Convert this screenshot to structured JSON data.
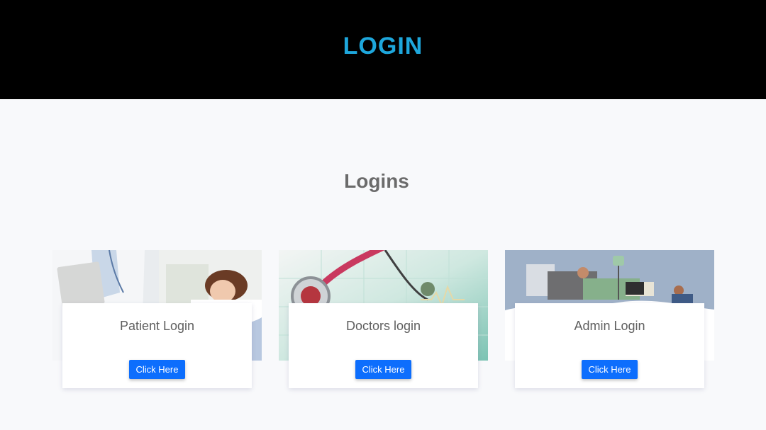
{
  "header": {
    "title": "LOGIN"
  },
  "section": {
    "title": "Logins"
  },
  "cards": [
    {
      "label": "Patient Login",
      "button_label": "Click Here",
      "image": "doctor-with-patient-photo"
    },
    {
      "label": "Doctors login",
      "button_label": "Click Here",
      "image": "stethoscope-photo"
    },
    {
      "label": "Admin Login",
      "button_label": "Click Here",
      "image": "hospital-admin-illustration"
    }
  ],
  "colors": {
    "header_bg": "#000000",
    "header_text": "#1ea7dc",
    "button": "#0d6efd",
    "page_bg": "#f8f9fb"
  }
}
